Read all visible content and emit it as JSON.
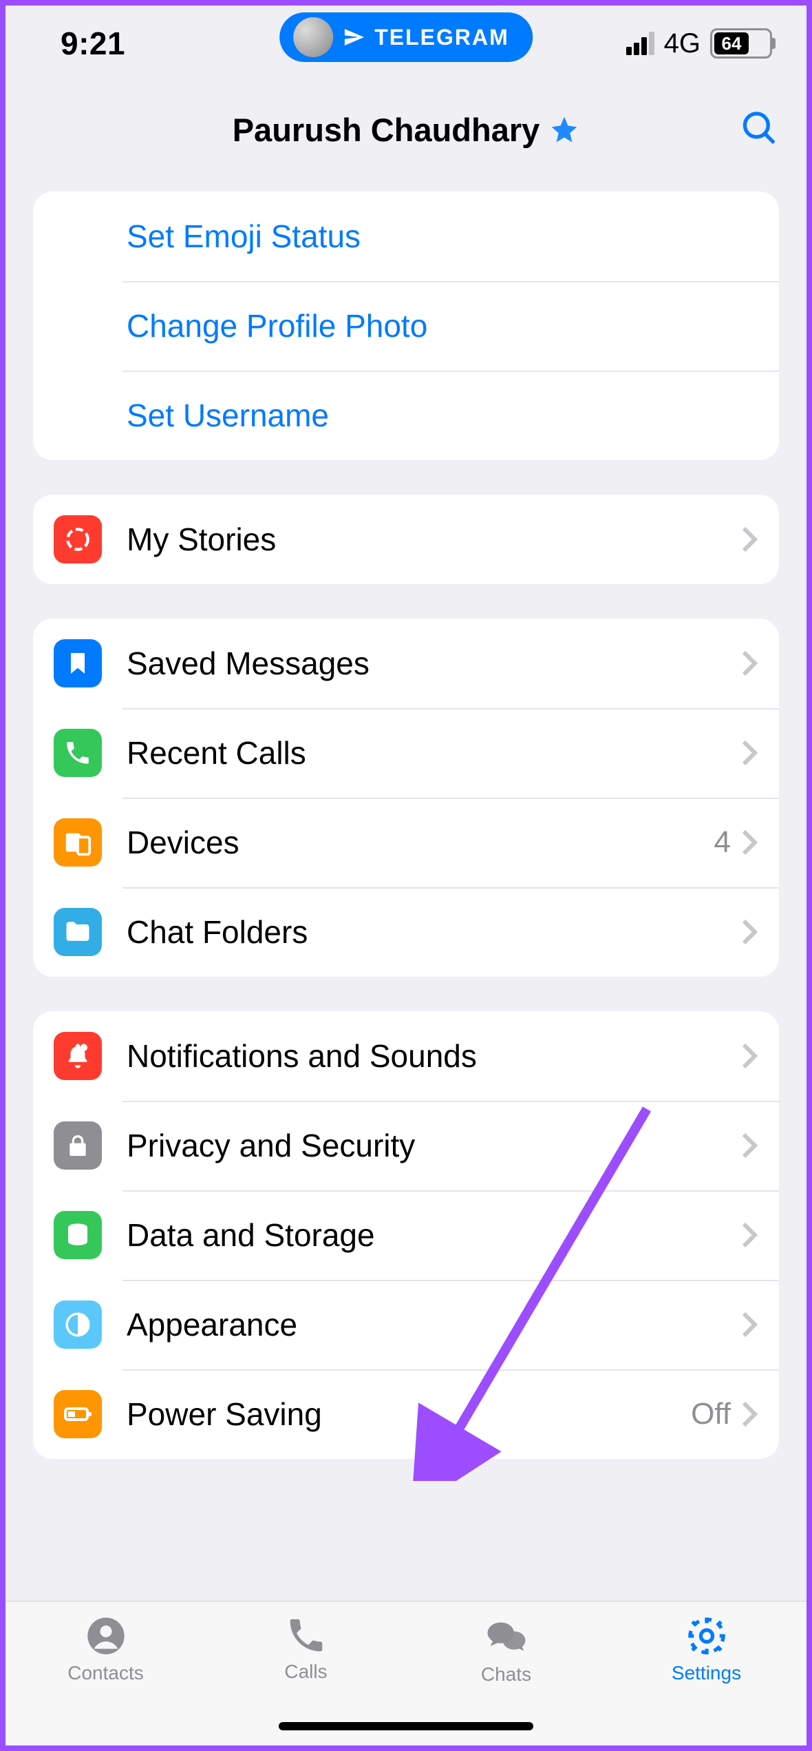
{
  "status": {
    "time": "9:21",
    "network": "4G",
    "battery_pct": 64
  },
  "island": {
    "app": "TELEGRAM"
  },
  "header": {
    "title": "Paurush Chaudhary"
  },
  "profile_actions": [
    {
      "icon": "emoji-plus-icon",
      "label": "Set Emoji Status"
    },
    {
      "icon": "camera-plus-icon",
      "label": "Change Profile Photo"
    },
    {
      "icon": "at-plus-icon",
      "label": "Set Username"
    }
  ],
  "groups": [
    {
      "rows": [
        {
          "icon": "stories-icon",
          "color": "sq-red",
          "label": "My Stories",
          "value": ""
        }
      ]
    },
    {
      "rows": [
        {
          "icon": "bookmark-icon",
          "color": "sq-blue",
          "label": "Saved Messages",
          "value": ""
        },
        {
          "icon": "phone-icon",
          "color": "sq-green",
          "label": "Recent Calls",
          "value": ""
        },
        {
          "icon": "devices-icon",
          "color": "sq-orange",
          "label": "Devices",
          "value": "4"
        },
        {
          "icon": "folder-icon",
          "color": "sq-sky",
          "label": "Chat Folders",
          "value": ""
        }
      ]
    },
    {
      "rows": [
        {
          "icon": "bell-icon",
          "color": "sq-red",
          "label": "Notifications and Sounds",
          "value": ""
        },
        {
          "icon": "lock-icon",
          "color": "sq-gray",
          "label": "Privacy and Security",
          "value": ""
        },
        {
          "icon": "database-icon",
          "color": "sq-green",
          "label": "Data and Storage",
          "value": ""
        },
        {
          "icon": "contrast-icon",
          "color": "sq-lightblue",
          "label": "Appearance",
          "value": ""
        },
        {
          "icon": "battery-icon",
          "color": "sq-orange",
          "label": "Power Saving",
          "value": "Off"
        }
      ]
    }
  ],
  "tabs": [
    {
      "icon": "person-icon",
      "label": "Contacts",
      "active": false
    },
    {
      "icon": "phone-icon",
      "label": "Calls",
      "active": false
    },
    {
      "icon": "chats-icon",
      "label": "Chats",
      "active": false
    },
    {
      "icon": "gear-icon",
      "label": "Settings",
      "active": true
    }
  ]
}
